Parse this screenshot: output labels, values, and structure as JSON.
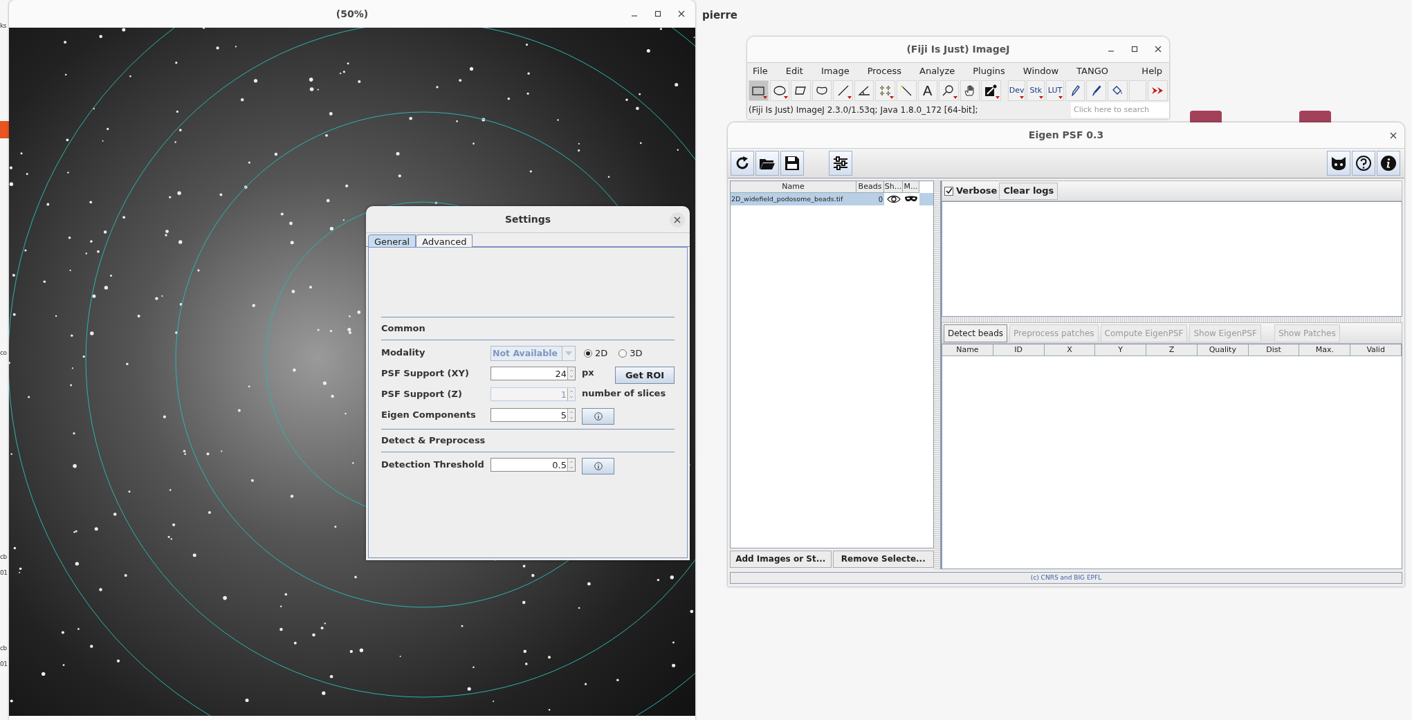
{
  "desktop": {
    "user": "pierre",
    "edge_fragments": [
      "ks",
      "co",
      "cb",
      "01",
      "cb",
      "01"
    ]
  },
  "image_window": {
    "title": "(50%)"
  },
  "imagej": {
    "title": "(Fiji Is Just) ImageJ",
    "menu": [
      "File",
      "Edit",
      "Image",
      "Process",
      "Analyze",
      "Plugins",
      "Window",
      "TANGO",
      "Help"
    ],
    "tools": [
      {
        "kind": "rect",
        "selected": true,
        "dropdown": true
      },
      {
        "kind": "oval",
        "selected": false,
        "dropdown": true
      },
      {
        "kind": "polygon",
        "selected": false,
        "dropdown": false
      },
      {
        "kind": "freehand",
        "selected": false,
        "dropdown": false
      },
      {
        "kind": "line",
        "selected": false,
        "dropdown": true
      },
      {
        "kind": "angle",
        "selected": false,
        "dropdown": false
      },
      {
        "kind": "points",
        "selected": false,
        "dropdown": true
      },
      {
        "kind": "wand",
        "selected": false,
        "dropdown": false
      },
      {
        "kind": "label",
        "label": "A",
        "selected": false,
        "dropdown": false
      },
      {
        "kind": "zoom",
        "selected": false,
        "dropdown": true
      },
      {
        "kind": "hand",
        "selected": false,
        "dropdown": false
      },
      {
        "kind": "picker",
        "selected": false,
        "dropdown": true
      },
      {
        "kind": "label",
        "label": "Dev",
        "selected": false,
        "dropdown": true
      },
      {
        "kind": "label",
        "label": "Stk",
        "selected": false,
        "dropdown": true
      },
      {
        "kind": "label",
        "label": "LUT",
        "selected": false,
        "dropdown": true
      },
      {
        "kind": "pencil",
        "selected": false,
        "dropdown": false
      },
      {
        "kind": "brush",
        "selected": false,
        "dropdown": false
      },
      {
        "kind": "bucket",
        "selected": false,
        "dropdown": false
      },
      {
        "kind": "empty",
        "selected": false,
        "dropdown": false
      },
      {
        "kind": "more",
        "selected": false,
        "dropdown": false
      }
    ],
    "status": "(Fiji Is Just) ImageJ 2.3.0/1.53q; Java 1.8.0_172 [64-bit];",
    "search": {
      "placeholder": "Click here to search"
    }
  },
  "settings": {
    "title": "Settings",
    "tabs": [
      {
        "label": "General",
        "selected": true
      },
      {
        "label": "Advanced",
        "selected": false
      }
    ],
    "sections": [
      {
        "title": "Common",
        "rows": [
          {
            "kind": "combo",
            "label": "Modality",
            "value": "Not Available",
            "disabled": true,
            "radios": [
              {
                "label": "2D",
                "selected": true
              },
              {
                "label": "3D",
                "selected": false
              }
            ]
          },
          {
            "kind": "spinner",
            "label": "PSF Support (XY)",
            "value": "24",
            "disabled": false,
            "unit": "px",
            "button": "Get ROI"
          },
          {
            "kind": "spinner",
            "label": "PSF Support (Z)",
            "value": "1",
            "disabled": true,
            "unit": "number of slices"
          },
          {
            "kind": "spinner",
            "label": "Eigen Components",
            "value": "5",
            "disabled": false,
            "info": true
          }
        ]
      },
      {
        "title": "Detect & Preprocess",
        "rows": [
          {
            "kind": "spinner",
            "label": "Detection Threshold",
            "value": "0.5",
            "disabled": false,
            "info": true
          }
        ]
      }
    ]
  },
  "eigen": {
    "title": "Eigen PSF 0.3",
    "files": {
      "columns": [
        "Name",
        "Beads",
        "Sh...",
        "M..."
      ],
      "rows": [
        {
          "name": "2D_widefield_podosome_beads.tif",
          "beads": "0",
          "selected": true
        }
      ]
    },
    "file_buttons": [
      "Add Images or St...",
      "Remove Selecte..."
    ],
    "verbose": {
      "label": "Verbose",
      "checked": true
    },
    "clear_logs": "Clear logs",
    "actions": [
      {
        "label": "Detect beads",
        "disabled": false
      },
      {
        "label": "Preprocess patches",
        "disabled": true
      },
      {
        "label": "Compute EigenPSF",
        "disabled": true
      },
      {
        "label": "Show EigenPSF",
        "disabled": true
      },
      {
        "label": "Show Patches",
        "disabled": true
      }
    ],
    "bead_columns": [
      "Name",
      "ID",
      "X",
      "Y",
      "Z",
      "Quality",
      "Dist",
      "Max.",
      "Valid"
    ],
    "footer": "(c) CNRS and BIG EPFL"
  }
}
